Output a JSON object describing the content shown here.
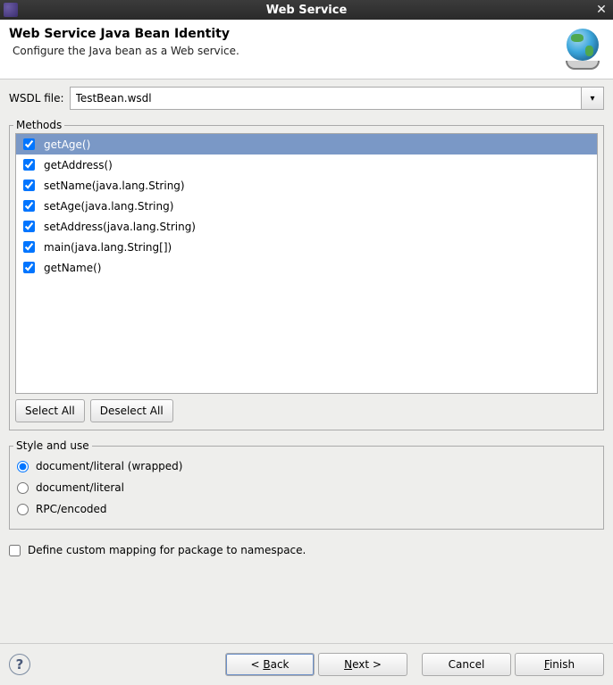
{
  "titlebar": {
    "title": "Web Service"
  },
  "header": {
    "heading": "Web Service Java Bean Identity",
    "sub": "Configure the Java bean as a Web service."
  },
  "wsdl": {
    "label": "WSDL file:",
    "value": "TestBean.wsdl"
  },
  "methods": {
    "legend": "Methods",
    "items": [
      {
        "label": "getAge()",
        "checked": true,
        "selected": true
      },
      {
        "label": "getAddress()",
        "checked": true,
        "selected": false
      },
      {
        "label": "setName(java.lang.String)",
        "checked": true,
        "selected": false
      },
      {
        "label": "setAge(java.lang.String)",
        "checked": true,
        "selected": false
      },
      {
        "label": "setAddress(java.lang.String)",
        "checked": true,
        "selected": false
      },
      {
        "label": "main(java.lang.String[])",
        "checked": true,
        "selected": false
      },
      {
        "label": "getName()",
        "checked": true,
        "selected": false
      }
    ],
    "select_all": "Select All",
    "deselect_all": "Deselect All"
  },
  "style": {
    "legend": "Style and use",
    "options": [
      {
        "label": "document/literal (wrapped)",
        "checked": true
      },
      {
        "label": "document/literal",
        "checked": false
      },
      {
        "label": "RPC/encoded",
        "checked": false
      }
    ]
  },
  "custom_mapping": {
    "label": "Define custom mapping for package to namespace.",
    "checked": false
  },
  "footer": {
    "back": "Back",
    "back_prefix": "< ",
    "next": "Next",
    "next_suffix": " >",
    "cancel": "Cancel",
    "finish": "Finish"
  }
}
